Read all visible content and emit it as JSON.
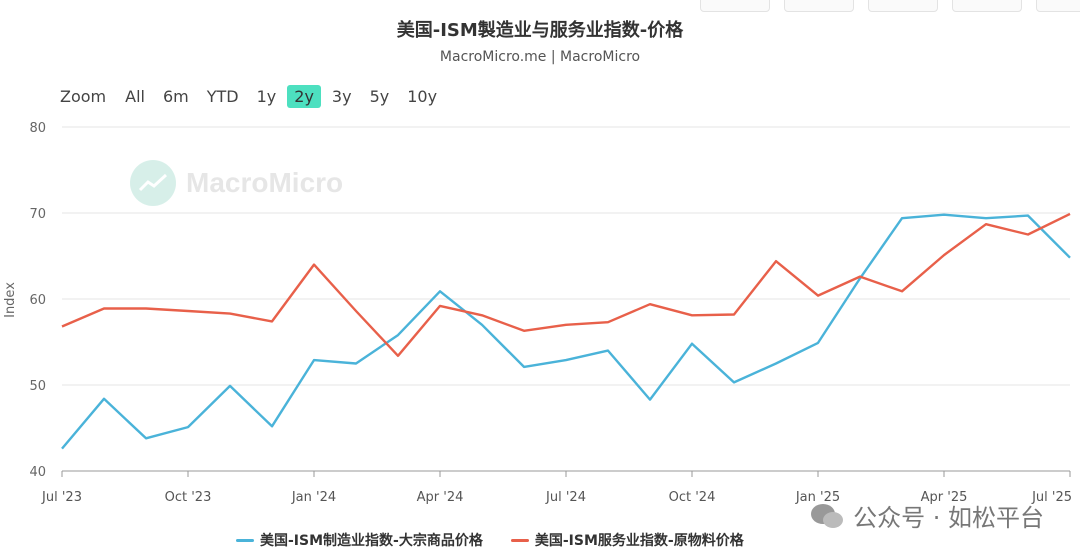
{
  "title": "美国-ISM製造业与服务业指数-价格",
  "subtitle": "MacroMicro.me | MacroMicro",
  "zoom": {
    "label": "Zoom",
    "options": [
      "All",
      "6m",
      "YTD",
      "1y",
      "2y",
      "3y",
      "5y",
      "10y"
    ],
    "active": "2y"
  },
  "watermark_text": "MacroMicro",
  "wechat_text": "公众号 · 如松平台",
  "chart_data": {
    "type": "line",
    "ylabel": "Index",
    "ylim": [
      40,
      80
    ],
    "yticks": [
      40,
      50,
      60,
      70,
      80
    ],
    "xticks": [
      "Jul '23",
      "Oct '23",
      "Jan '24",
      "Apr '24",
      "Jul '24",
      "Oct '24",
      "Jan '25",
      "Apr '25",
      "Jul '25"
    ],
    "x": [
      "2023-07",
      "2023-08",
      "2023-09",
      "2023-10",
      "2023-11",
      "2023-12",
      "2024-01",
      "2024-02",
      "2024-03",
      "2024-04",
      "2024-05",
      "2024-06",
      "2024-07",
      "2024-08",
      "2024-09",
      "2024-10",
      "2024-11",
      "2024-12",
      "2025-01",
      "2025-02",
      "2025-03",
      "2025-04",
      "2025-05",
      "2025-06",
      "2025-07"
    ],
    "series": [
      {
        "name": "美国-ISM制造业指数-大宗商品价格",
        "color": "#4ab3d9",
        "values": [
          42.6,
          48.4,
          43.8,
          45.1,
          49.9,
          45.2,
          52.9,
          52.5,
          55.8,
          60.9,
          57.0,
          52.1,
          52.9,
          54.0,
          48.3,
          54.8,
          50.3,
          52.5,
          54.9,
          62.4,
          69.4,
          69.8,
          69.4,
          69.7,
          64.8
        ]
      },
      {
        "name": "美国-ISM服务业指数-原物料价格",
        "color": "#e8604a",
        "values": [
          56.8,
          58.9,
          58.9,
          58.6,
          58.3,
          57.4,
          64.0,
          58.6,
          53.4,
          59.2,
          58.1,
          56.3,
          57.0,
          57.3,
          59.4,
          58.1,
          58.2,
          64.4,
          60.4,
          62.6,
          60.9,
          65.1,
          68.7,
          67.5,
          69.9
        ]
      }
    ],
    "grid": true,
    "legend": "bottom"
  }
}
